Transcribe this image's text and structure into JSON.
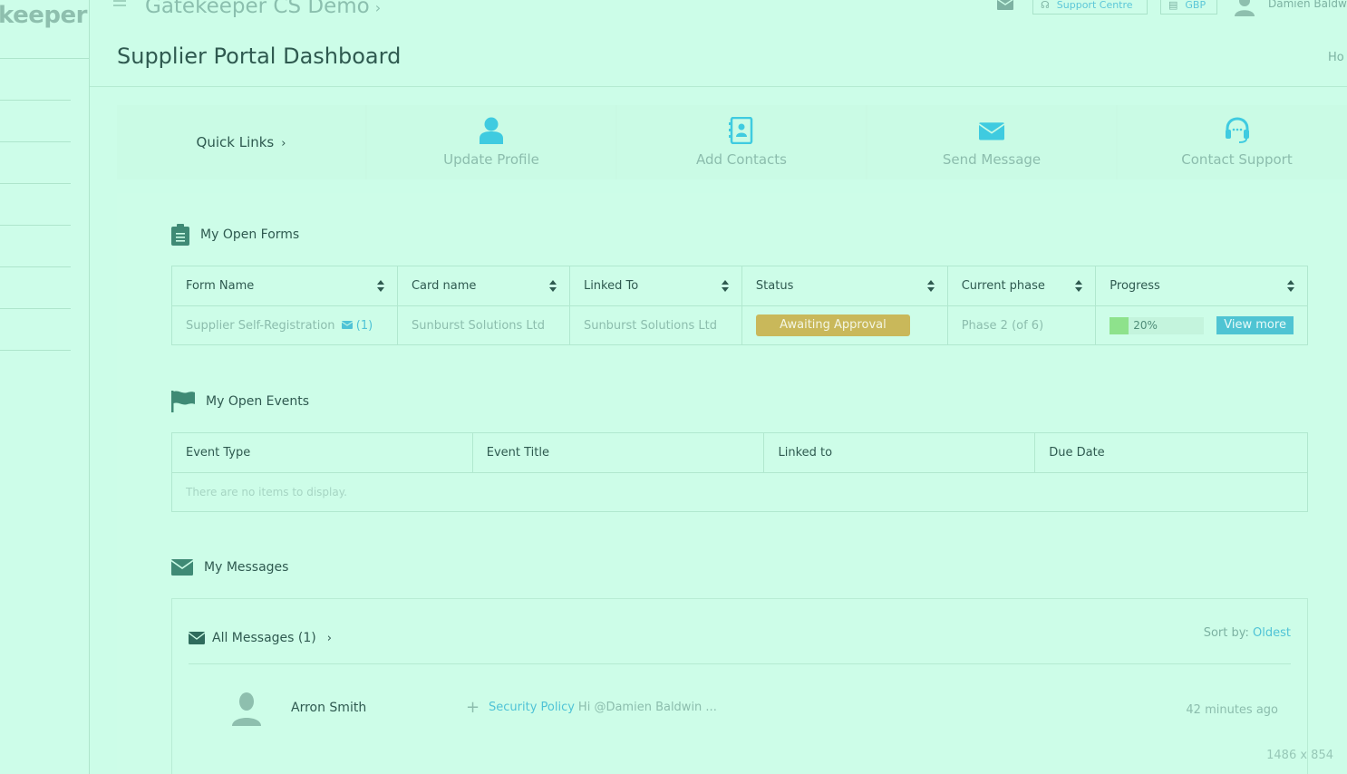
{
  "sidebar": {
    "brand": "keeper"
  },
  "topbar": {
    "app_title": "Gatekeeper CS Demo",
    "support_label": "Support Centre",
    "currency_label": "GBP",
    "user_name": "Damien Baldw"
  },
  "page": {
    "title": "Supplier Portal Dashboard",
    "breadcrumb": "Ho"
  },
  "quick_links": {
    "title": "Quick Links",
    "items": [
      {
        "label": "Update Profile",
        "icon": "user-icon"
      },
      {
        "label": "Add Contacts",
        "icon": "address-book-icon"
      },
      {
        "label": "Send Message",
        "icon": "envelope-icon"
      },
      {
        "label": "Contact Support",
        "icon": "headset-icon"
      }
    ]
  },
  "open_forms": {
    "title": "My Open Forms",
    "columns": [
      "Form Name",
      "Card name",
      "Linked To",
      "Status",
      "Current phase",
      "Progress"
    ],
    "rows": [
      {
        "form_name": "Supplier Self-Registration",
        "message_count": "(1)",
        "card_name": "Sunburst Solutions Ltd",
        "linked_to": "Sunburst Solutions Ltd",
        "status": "Awaiting Approval",
        "phase": "Phase 2 (of 6)",
        "progress_text": "20%",
        "progress_value": 0.2,
        "action_label": "View more"
      }
    ]
  },
  "open_events": {
    "title": "My Open Events",
    "columns": [
      "Event Type",
      "Event Title",
      "Linked to",
      "Due Date"
    ],
    "empty_text": "There are no items to display."
  },
  "messages": {
    "title": "My Messages",
    "all_label": "All Messages (1)",
    "sort_label": "Sort by:",
    "sort_value": "Oldest",
    "items": [
      {
        "sender": "Arron Smith",
        "subject": "Security Policy",
        "preview": "Hi @Damien Baldwin ...",
        "time": "42 minutes ago"
      }
    ]
  },
  "dimensions_label": "1486 x 854",
  "colors": {
    "background": "#ccfde8",
    "accent": "#4fc3d6",
    "status_badge": "#c9b85a",
    "progress_fill": "#8ee28c",
    "heading_text": "#2f5a50"
  }
}
